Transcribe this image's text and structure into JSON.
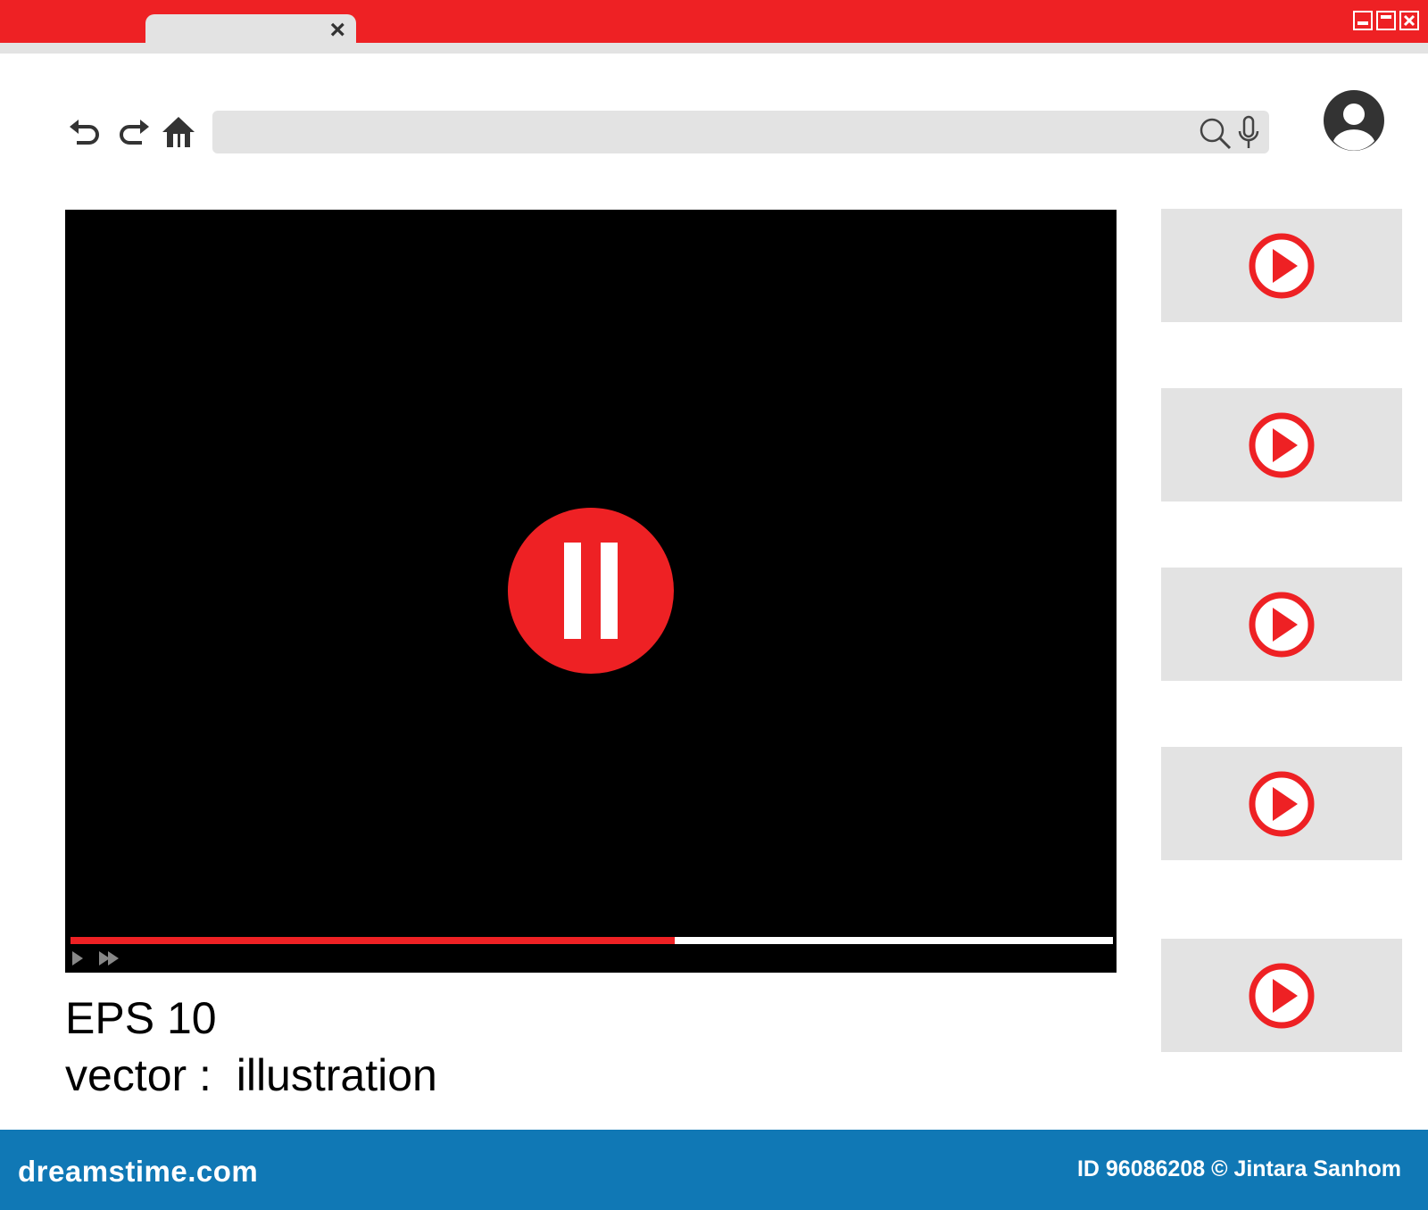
{
  "browser": {
    "tab_close_symbol": "×",
    "address_value": "",
    "colors": {
      "brand": "#ee2124",
      "chrome": "#e3e3e3",
      "footer": "#1078b5"
    },
    "icons": [
      "undo-icon",
      "redo-icon",
      "home-icon",
      "search-icon",
      "mic-icon",
      "user-avatar-icon",
      "minimize-icon",
      "maximize-icon",
      "close-icon"
    ]
  },
  "player": {
    "progress_fraction": 0.58,
    "state_icon": "pause-icon"
  },
  "caption": {
    "line1": "EPS 10",
    "line2": "vector :  illustration"
  },
  "sidebar": {
    "thumbnails": [
      {
        "icon": "play-icon"
      },
      {
        "icon": "play-icon"
      },
      {
        "icon": "play-icon"
      },
      {
        "icon": "play-icon"
      },
      {
        "icon": "play-icon"
      }
    ]
  },
  "footer": {
    "site": "dreamstime.com",
    "credit": "ID 96086208 © Jintara Sanhom"
  }
}
